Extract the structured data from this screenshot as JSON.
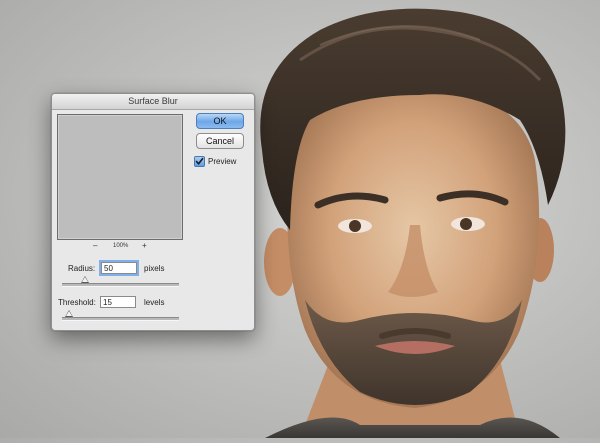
{
  "dialog": {
    "title": "Surface Blur",
    "ok_label": "OK",
    "cancel_label": "Cancel",
    "preview_label": "Preview",
    "preview_checked": true,
    "zoom": {
      "minus": "–",
      "level": "100%",
      "plus": "+"
    },
    "radius": {
      "label": "Radius:",
      "value": "50",
      "unit": "pixels",
      "slider_fraction": 0.2
    },
    "threshold": {
      "label": "Threshold:",
      "value": "15",
      "unit": "levels",
      "slider_fraction": 0.06
    }
  },
  "colors": {
    "ok_accent": "#6da7e8",
    "preview_fill": "#bdbdbd",
    "background": "#c4c4c2"
  }
}
